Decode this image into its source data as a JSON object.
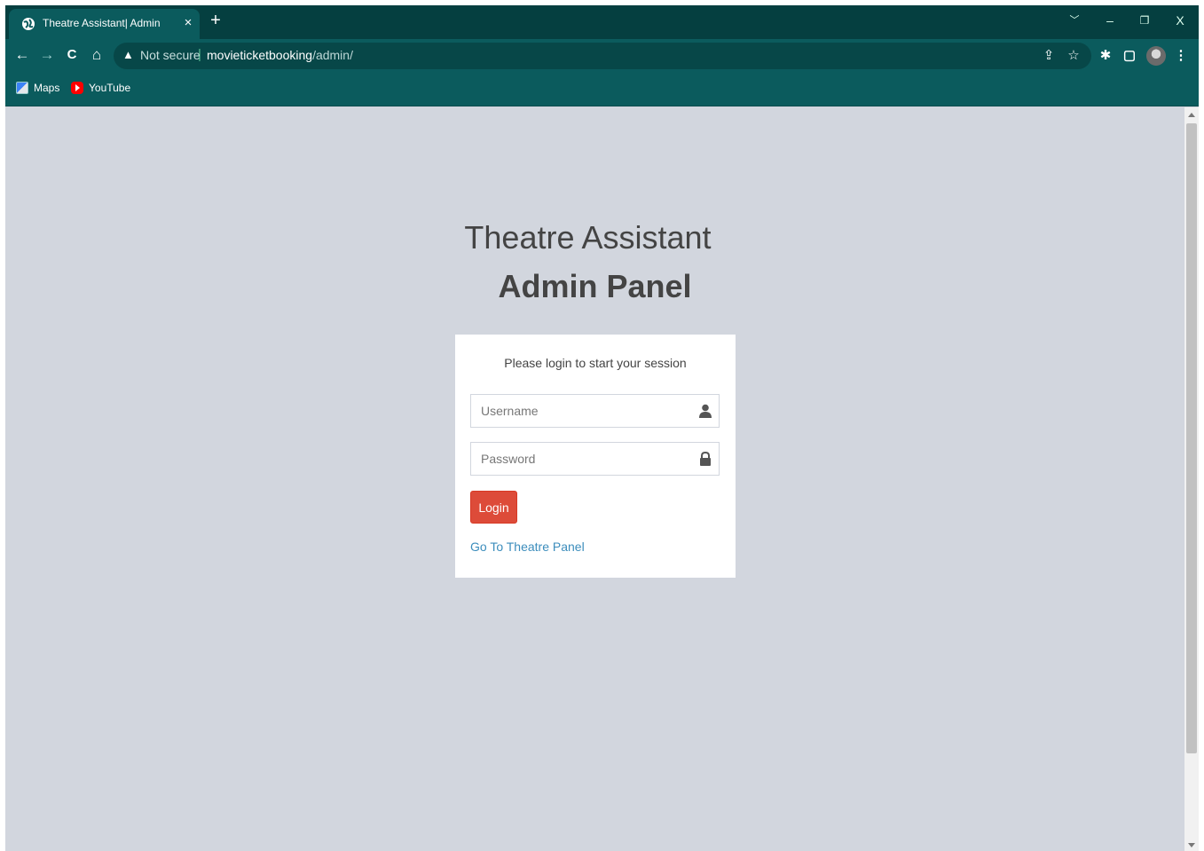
{
  "browser": {
    "tab": {
      "title": "Theatre Assistant| Admin",
      "close": "×"
    },
    "new_tab": "+",
    "window_controls": {
      "tabs_menu": "﹀",
      "minimize": "–",
      "restore": "❐",
      "close": "X"
    },
    "toolbar": {
      "back": "←",
      "forward": "→",
      "reload": "C",
      "home": "⌂",
      "security_warning_icon": "▲",
      "security_label": "Not secure",
      "separator": "|",
      "url_host": "movieticketbooking",
      "url_path": "/admin/",
      "share": "⇪",
      "bookmark_star": "☆",
      "extensions": "✱",
      "side_panel": "▢",
      "menu": "⋮"
    },
    "bookmarks": [
      {
        "label": "Maps",
        "icon": "maps-icon"
      },
      {
        "label": "YouTube",
        "icon": "youtube-icon"
      }
    ]
  },
  "page": {
    "logo": {
      "line1": "Theatre Assistant",
      "line2": "Admin Panel"
    },
    "login": {
      "message": "Please login to start your session",
      "username_placeholder": "Username",
      "username_value": "",
      "password_placeholder": "Password",
      "password_value": "",
      "login_button": "Login",
      "theatre_link": "Go To Theatre Panel"
    }
  },
  "colors": {
    "browser_frame": "#053f40",
    "toolbar": "#0b5b5d",
    "page_background": "#d2d6de",
    "login_button": "#dd4b39",
    "link": "#3c8dbc"
  }
}
